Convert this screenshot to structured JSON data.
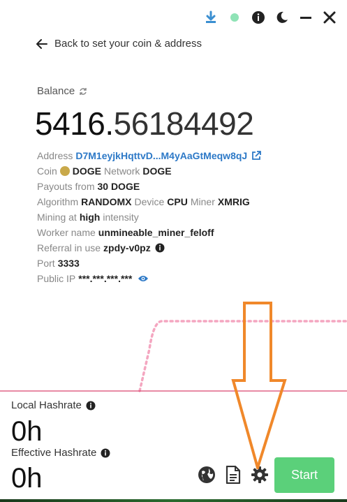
{
  "titlebar": {
    "icons": [
      "download-icon",
      "status-dot",
      "info-icon",
      "moon-icon",
      "minimize-icon",
      "close-icon"
    ],
    "status_color": "#8fe3b6"
  },
  "back": {
    "label": "Back to set your coin & address"
  },
  "balance": {
    "label": "Balance",
    "integer": "5416.",
    "fraction": "56184492"
  },
  "info": {
    "address_label": "Address",
    "address_value": "D7M1eyjkHqttvD...M4yAaGtMeqw8qJ",
    "coin_label": "Coin",
    "coin_value": "DOGE",
    "network_label": "Network",
    "network_value": "DOGE",
    "payouts_label": "Payouts from",
    "payouts_value": "30 DOGE",
    "algorithm_label": "Algorithm",
    "algorithm_value": "RANDOMX",
    "device_label": "Device",
    "device_value": "CPU",
    "miner_label": "Miner",
    "miner_value": "XMRIG",
    "mining_at_label": "Mining at",
    "mining_at_value": "high",
    "intensity_label": "intensity",
    "worker_label": "Worker name",
    "worker_value": "unmineable_miner_feloff",
    "referral_label": "Referral in use",
    "referral_value": "zpdy-v0pz",
    "port_label": "Port",
    "port_value": "3333",
    "ip_label": "Public IP",
    "ip_value": "***.***.***.***"
  },
  "stats": {
    "local_label": "Local Hashrate",
    "local_value": "0h",
    "effective_label": "Effective Hashrate",
    "effective_value": "0h"
  },
  "actions": {
    "start_label": "Start",
    "icons": [
      "globe-icon",
      "file-icon",
      "gear-icon"
    ]
  },
  "colors": {
    "accent": "#2d79c7",
    "start": "#5bd07a",
    "chart_dotted": "#f4a6c0",
    "chart_line": "#d9456f",
    "arrow": "#f0882a"
  }
}
